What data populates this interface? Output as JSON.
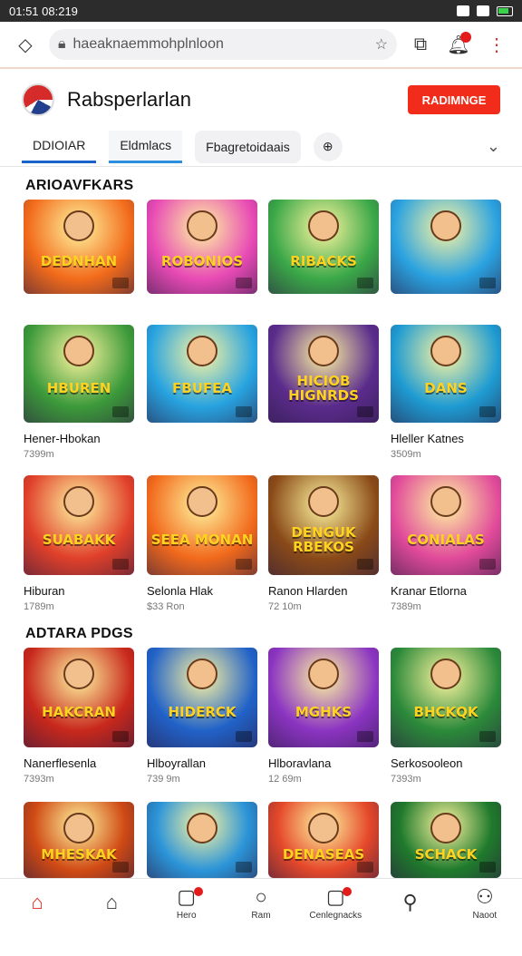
{
  "statusbar": {
    "time": "01:51 08:219"
  },
  "browser": {
    "url": "haeaknaemmohplnloon",
    "tab_count": "",
    "icons": [
      "diamond-icon",
      "lock-icon",
      "star-icon",
      "tabs-icon",
      "bell-icon",
      "kebab-icon"
    ]
  },
  "app": {
    "title": "Rabsperlarlan",
    "cta_label": "RADIMNGE"
  },
  "tabs": [
    {
      "label": "DDIOIAR"
    },
    {
      "label": "Eldmlacs"
    },
    {
      "label": "Fbagretoidaais"
    }
  ],
  "sections": [
    {
      "title": "ARIOAVFKARS"
    },
    {
      "title": "ADTARA PDGS"
    }
  ],
  "rows": [
    {
      "cards": [
        {
          "title_art": "DEDNHAN",
          "bg": "#f26b1b",
          "name": "",
          "meta": ""
        },
        {
          "title_art": "ROBONIOS",
          "bg": "#e84ab5",
          "name": "",
          "meta": ""
        },
        {
          "title_art": "RIBACKS",
          "bg": "#3aa848",
          "name": "",
          "meta": ""
        },
        {
          "title_art": "",
          "bg": "#2aa2e0",
          "name": "",
          "meta": ""
        }
      ]
    },
    {
      "cards": [
        {
          "title_art": "HBUREN",
          "bg": "#3c9a3a",
          "name": "Hener-Hbokan",
          "meta": "7399m"
        },
        {
          "title_art": "FBUFEA",
          "bg": "#27a3e0",
          "name": "",
          "meta": ""
        },
        {
          "title_art": "HICIOB HIGNRDS",
          "bg": "#5a2b8c",
          "name": "",
          "meta": ""
        },
        {
          "title_art": "DANS",
          "bg": "#1e9bd2",
          "name": "Hleller Katnes",
          "meta": "3509m"
        }
      ]
    },
    {
      "cards": [
        {
          "title_art": "SUABAKK",
          "bg": "#e0402a",
          "name": "Hiburan",
          "meta": "1789m"
        },
        {
          "title_art": "SEEA MONAN",
          "bg": "#f26a1c",
          "name": "Selonla Hlak",
          "meta": "$33 Ron"
        },
        {
          "title_art": "DENGUK RBEKOS",
          "bg": "#8a4a18",
          "name": "Ranon Hlarden",
          "meta": "72 10m"
        },
        {
          "title_art": "CONIALAS",
          "bg": "#e14a9a",
          "name": "Kranar Etlorna",
          "meta": "7389m"
        }
      ]
    },
    {
      "cards": [
        {
          "title_art": "HAKCRAN",
          "bg": "#c8281c",
          "name": "Nanerflesenla",
          "meta": "7393m"
        },
        {
          "title_art": "HIDERCK",
          "bg": "#2162c8",
          "name": "Hlboyrallan",
          "meta": "739 9m"
        },
        {
          "title_art": "MGHKS",
          "bg": "#8b34c2",
          "name": "Hlboravlana",
          "meta": "12 69m"
        },
        {
          "title_art": "BHCKQK",
          "bg": "#2b8a3a",
          "name": "Serkosooleon",
          "meta": "7393m"
        }
      ]
    },
    {
      "cards": [
        {
          "title_art": "MHESKAK",
          "bg": "#d04a14",
          "name": "",
          "meta": ""
        },
        {
          "title_art": "",
          "bg": "#2b94d8",
          "name": "",
          "meta": ""
        },
        {
          "title_art": "DENASEAS",
          "bg": "#e5482a",
          "name": "",
          "meta": ""
        },
        {
          "title_art": "SCHACK",
          "bg": "#1f7a2c",
          "name": "",
          "meta": ""
        }
      ]
    }
  ],
  "bottomnav": [
    {
      "label": "",
      "icon": "home-icon",
      "glyph": "⌂"
    },
    {
      "label": "",
      "icon": "store-icon",
      "glyph": "⌂"
    },
    {
      "label": "Hero",
      "icon": "bag-icon",
      "glyph": "▢"
    },
    {
      "label": "Ram",
      "icon": "circle-icon",
      "glyph": "○"
    },
    {
      "label": "Cenlegnacks",
      "icon": "bag2-icon",
      "glyph": "▢"
    },
    {
      "label": "",
      "icon": "search-icon",
      "glyph": "⚲"
    },
    {
      "label": "Naoot",
      "icon": "user-icon",
      "glyph": "⚇"
    }
  ]
}
